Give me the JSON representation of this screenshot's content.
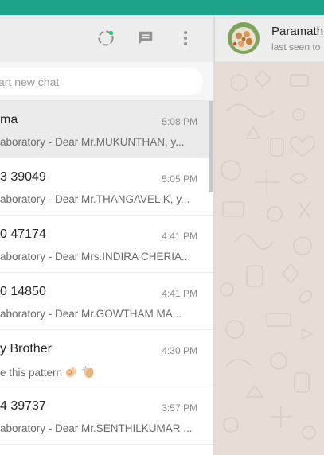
{
  "sidebar": {
    "header": {
      "status_icon": "status-ring-icon",
      "new_chat_icon": "new-chat-icon",
      "menu_icon": "kebab-menu-icon"
    },
    "search": {
      "placeholder": "art new chat"
    },
    "chats": [
      {
        "name": "ma",
        "time": "5:08 PM",
        "preview": "aboratory - Dear Mr.MUKUNTHAN, y...",
        "active": true
      },
      {
        "name": "3 39049",
        "time": "5:05 PM",
        "preview": "aboratory - Dear Mr.THANGAVEL K, y..."
      },
      {
        "name": "0 47174",
        "time": "4:41 PM",
        "preview": "aboratory - Dear Mrs.INDIRA CHERIA..."
      },
      {
        "name": "0 14850",
        "time": "4:41 PM",
        "preview": "aboratory - Dear Mr.GOWTHAM MA..."
      },
      {
        "name": "y Brother",
        "time": "4:30 PM",
        "preview": "e this pattern",
        "emojis": [
          "ok-hand-emoji",
          "clapping-hands-emoji"
        ]
      },
      {
        "name": "4 39737",
        "time": "3:57 PM",
        "preview": "aboratory - Dear Mr.SENTHILKUMAR ..."
      }
    ]
  },
  "conversation": {
    "contact_name": "Paramath",
    "contact_status": "last seen to",
    "avatar_icon": "contact-avatar"
  },
  "colors": {
    "brand": "#1ea38a",
    "header_bg": "#ededed",
    "active_row": "#ebebeb",
    "chat_wallpaper": "#e6ded5",
    "status_dot": "#09d261"
  }
}
